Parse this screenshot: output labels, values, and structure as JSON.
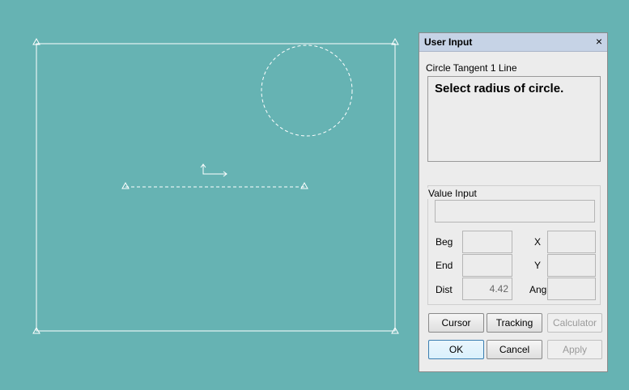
{
  "dialog": {
    "title": "User Input",
    "close_glyph": "×",
    "command_name": "Circle Tangent 1 Line",
    "prompt": "Select radius of circle."
  },
  "value_input": {
    "legend": "Value Input",
    "value": "",
    "beg_label": "Beg",
    "end_label": "End",
    "dist_label": "Dist",
    "x_label": "X",
    "y_label": "Y",
    "ang_label": "Ang",
    "beg_value": "",
    "end_value": "",
    "dist_value": "4.42",
    "x_value": "",
    "y_value": "",
    "ang_value": ""
  },
  "buttons": {
    "cursor": "Cursor",
    "tracking": "Tracking",
    "calculator": "Calculator",
    "ok": "OK",
    "cancel": "Cancel",
    "apply": "Apply"
  },
  "colors": {
    "canvas_bg": "#66b3b3",
    "drawing": "#ffffff",
    "panel_bg": "#ececec"
  }
}
